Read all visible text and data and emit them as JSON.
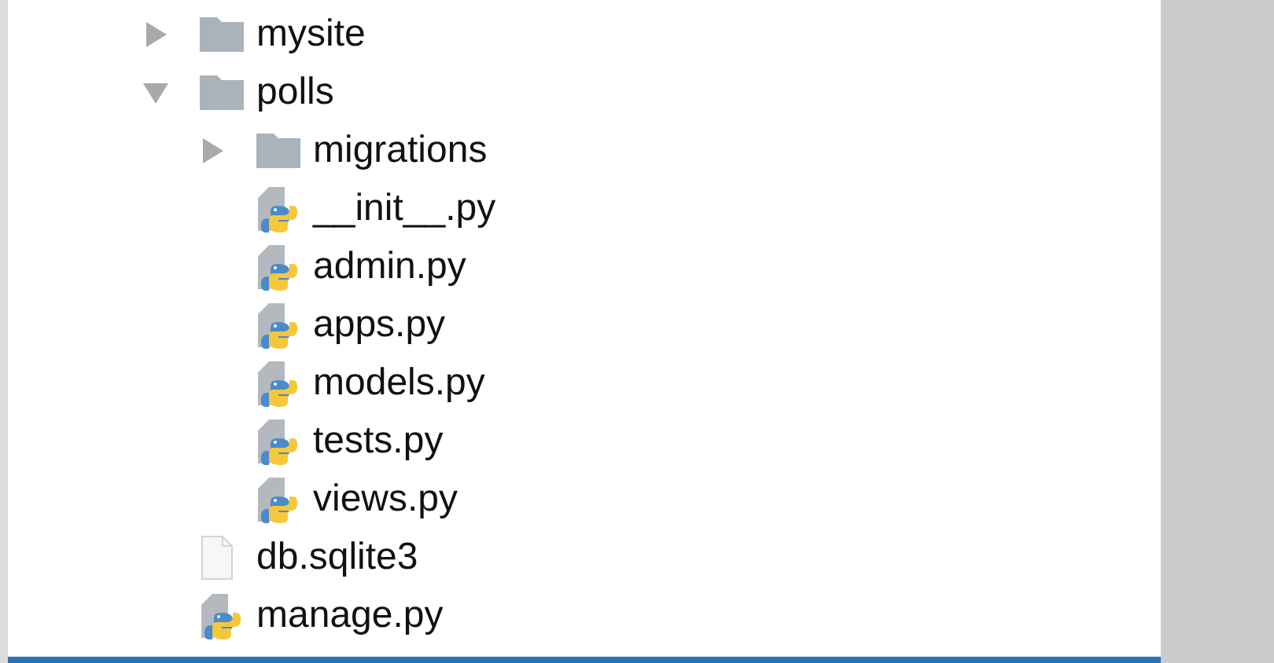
{
  "tree": [
    {
      "label": "mysite",
      "kind": "folder",
      "expanded": false
    },
    {
      "label": "polls",
      "kind": "folder",
      "expanded": true,
      "children": [
        {
          "label": "migrations",
          "kind": "folder",
          "expanded": false
        },
        {
          "label": "__init__.py",
          "kind": "python"
        },
        {
          "label": "admin.py",
          "kind": "python"
        },
        {
          "label": "apps.py",
          "kind": "python"
        },
        {
          "label": "models.py",
          "kind": "python"
        },
        {
          "label": "tests.py",
          "kind": "python"
        },
        {
          "label": "views.py",
          "kind": "python"
        }
      ]
    },
    {
      "label": "db.sqlite3",
      "kind": "file"
    },
    {
      "label": "manage.py",
      "kind": "python"
    }
  ]
}
